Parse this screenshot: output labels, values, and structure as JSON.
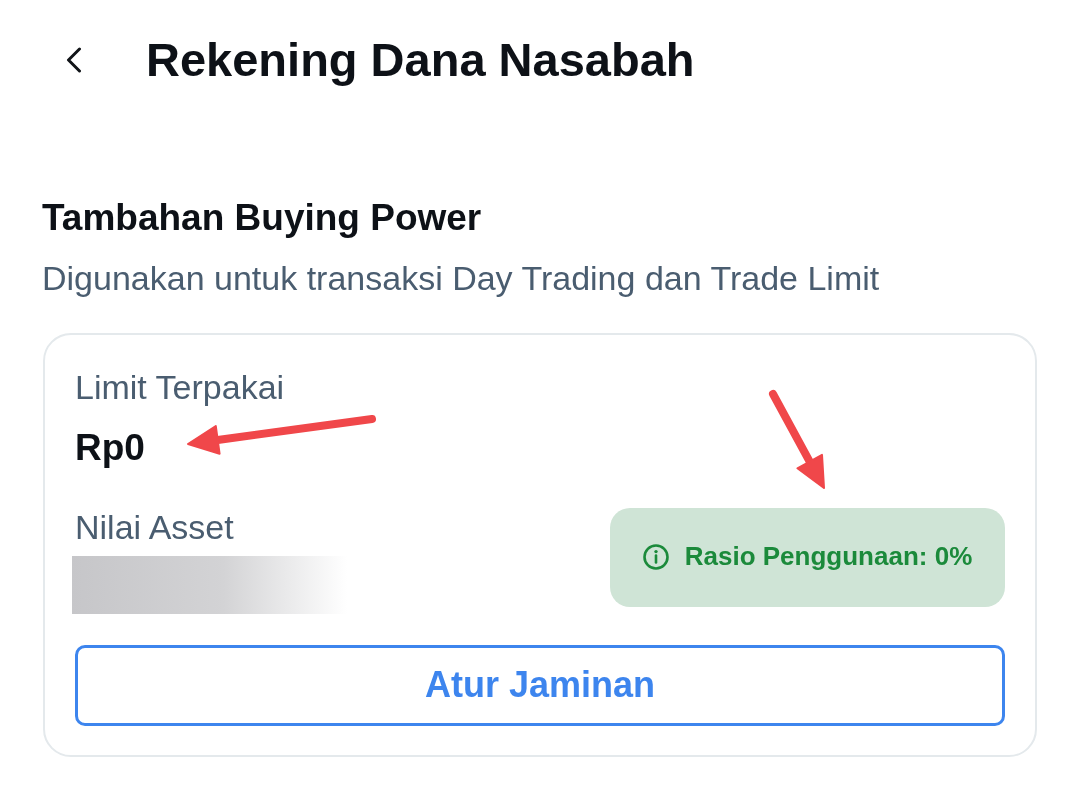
{
  "header": {
    "title": "Rekening Dana Nasabah"
  },
  "section": {
    "title": "Tambahan Buying Power",
    "subtitle": "Digunakan untuk transaksi Day Trading dan Trade Limit"
  },
  "card": {
    "used_limit": {
      "label": "Limit Terpakai",
      "value": "Rp0"
    },
    "asset_value": {
      "label": "Nilai Asset"
    },
    "usage_ratio": {
      "text": "Rasio Penggunaan: 0%"
    },
    "button": {
      "label": "Atur Jaminan"
    }
  }
}
